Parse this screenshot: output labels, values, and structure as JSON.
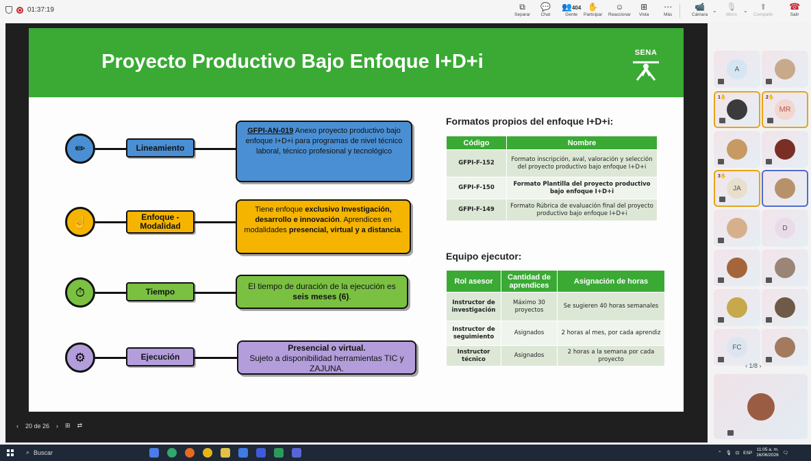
{
  "recorder": {
    "time": "01:37:19"
  },
  "toolbar": {
    "separar": "Separar",
    "chat": "Chat",
    "gente": "Gente",
    "gente_count": "404",
    "participar": "Participar",
    "reaccionar": "Reaccionar",
    "vista": "Vista",
    "mas": "Más",
    "camara": "Cámara",
    "micro": "Micro",
    "compartir": "Compartir",
    "salir": "Salir"
  },
  "slide": {
    "title": "Proyecto Productivo Bajo Enfoque I+D+i",
    "logo_text": "SENA",
    "rows": [
      {
        "label": "Lineamiento",
        "box_code": "GFPI-AN-019",
        "box_text": " Anexo proyecto productivo bajo enfoque I+D+i para programas de nivel técnico laboral, técnico profesional y tecnológico",
        "icon": "pencil-icon"
      },
      {
        "label": "Enfoque - Modalidad",
        "box_text_1": "Tiene enfoque ",
        "box_bold_1": "exclusivo Investigación, desarrollo e innovación",
        "box_text_2": ". Aprendices en modalidades ",
        "box_bold_2": "presencial, virtual y a distancia",
        "box_text_3": ".",
        "icon": "hand-icon"
      },
      {
        "label": "Tiempo",
        "box_text_1": "El tiempo de duración de la ejecución es ",
        "box_bold_1": "seis meses (6)",
        "box_text_2": ".",
        "icon": "clock-gear-icon"
      },
      {
        "label": "Ejecución",
        "box_bold_1": "Presencial o virtual.",
        "box_text_1": "Sujeto a disponibilidad herramientas TIC y ZAJUNA.",
        "icon": "gear-icon"
      }
    ],
    "formatos_title": "Formatos propios del enfoque I+D+i:",
    "formatos_headers": [
      "Código",
      "Nombre"
    ],
    "formatos_rows": [
      [
        "GFPI-F-152",
        "Formato inscripción, aval, valoración y selección del proyecto productivo bajo enfoque I+D+i"
      ],
      [
        "GFPI-F-150",
        "Formato Plantilla del proyecto productivo bajo enfoque I+D+i"
      ],
      [
        "GFPI-F-149",
        "Formato Rúbrica de evaluación final del proyecto productivo bajo enfoque I+D+i"
      ]
    ],
    "equipo_title": "Equipo ejecutor:",
    "equipo_headers": [
      "Rol asesor",
      "Cantidad de aprendices",
      "Asignación de horas"
    ],
    "equipo_rows": [
      [
        "Instructor de investigación",
        "Máximo 30 proyectos",
        "Se sugieren 40 horas semanales"
      ],
      [
        "Instructor de seguimiento",
        "Asignados",
        "2 horas al mes, por cada aprendiz"
      ],
      [
        "Instructor técnico",
        "Asignados",
        "2 horas a la semana por cada proyecto"
      ]
    ]
  },
  "slide_nav": {
    "page": "20 de 26"
  },
  "participants": {
    "tiles": [
      {
        "initials": "A"
      },
      {
        "initials": ""
      },
      {
        "initials": "",
        "hand": "1"
      },
      {
        "initials": "MR",
        "hand": "2"
      },
      {
        "initials": ""
      },
      {
        "initials": ""
      },
      {
        "initials": "JA",
        "hand": "3"
      },
      {
        "initials": ""
      },
      {
        "initials": ""
      },
      {
        "initials": "D"
      },
      {
        "initials": ""
      },
      {
        "initials": ""
      },
      {
        "initials": ""
      },
      {
        "initials": ""
      },
      {
        "initials": "FC"
      },
      {
        "initials": ""
      }
    ],
    "pager": "1/8"
  },
  "taskbar": {
    "search": "Buscar",
    "time": "11:05 a. m.",
    "date": "16/06/2026",
    "lang": "ESP"
  }
}
